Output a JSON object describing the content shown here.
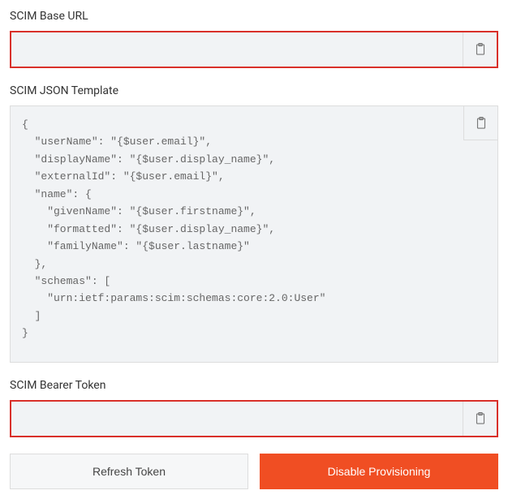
{
  "base_url": {
    "label": "SCIM Base URL",
    "value": ""
  },
  "json_template": {
    "label": "SCIM JSON Template",
    "value": "{\n  \"userName\": \"{$user.email}\",\n  \"displayName\": \"{$user.display_name}\",\n  \"externalId\": \"{$user.email}\",\n  \"name\": {\n    \"givenName\": \"{$user.firstname}\",\n    \"formatted\": \"{$user.display_name}\",\n    \"familyName\": \"{$user.lastname}\"\n  },\n  \"schemas\": [\n    \"urn:ietf:params:scim:schemas:core:2.0:User\"\n  ]\n}"
  },
  "bearer_token": {
    "label": "SCIM Bearer Token",
    "value": ""
  },
  "buttons": {
    "refresh": "Refresh Token",
    "disable": "Disable Provisioning"
  }
}
